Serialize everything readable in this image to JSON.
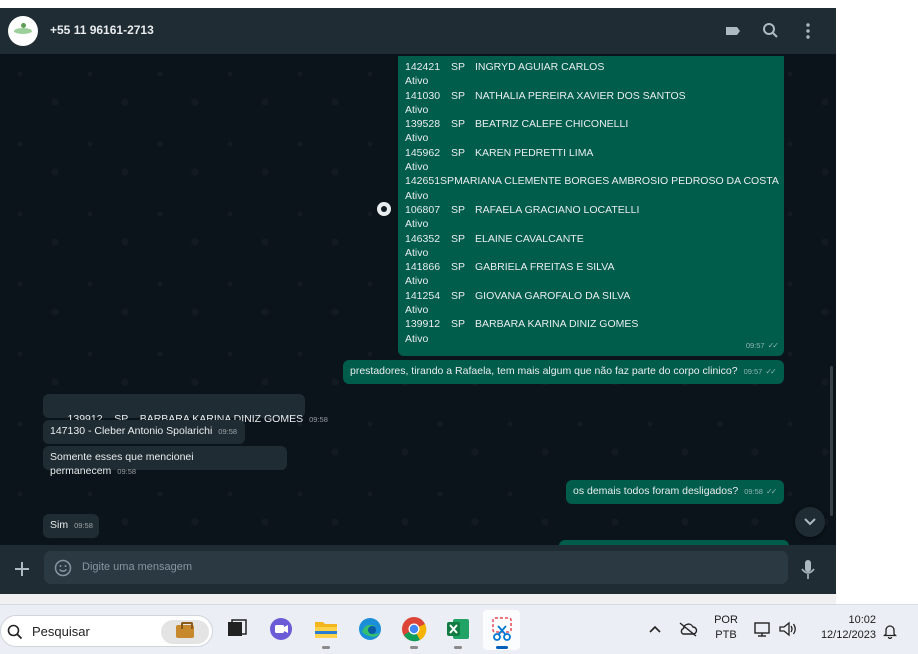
{
  "header": {
    "contact": "+55 11 96161-2713",
    "icons": [
      "label-icon",
      "search-icon",
      "menu-icon"
    ]
  },
  "list_rows": [
    {
      "id": "142421",
      "uf": "SP",
      "name": "INGRYD AGUIAR CARLOS",
      "status": "Ativo"
    },
    {
      "id": "141030",
      "uf": "SP",
      "name": "NATHALIA PEREIRA XAVIER DOS SANTOS",
      "status": "Ativo"
    },
    {
      "id": "139528",
      "uf": "SP",
      "name": "BEATRIZ CALEFE CHICONELLI",
      "status": "Ativo"
    },
    {
      "id": "145962",
      "uf": "SP",
      "name": "KAREN PEDRETTI LIMA",
      "status": "Ativo"
    },
    {
      "id": "142651",
      "uf": "SP",
      "name": "MARIANA CLEMENTE BORGES AMBROSIO PEDROSO DA COSTA",
      "status": "Ativo"
    },
    {
      "id": "106807",
      "uf": "SP",
      "name": "RAFAELA GRACIANO LOCATELLI",
      "status": "Ativo"
    },
    {
      "id": "146352",
      "uf": "SP",
      "name": "ELAINE CAVALCANTE",
      "status": "Ativo"
    },
    {
      "id": "141866",
      "uf": "SP",
      "name": "GABRIELA FREITAS E SILVA",
      "status": "Ativo"
    },
    {
      "id": "141254",
      "uf": "SP",
      "name": "GIOVANA GAROFALO DA SILVA",
      "status": "Ativo"
    },
    {
      "id": "139912",
      "uf": "SP",
      "name": "BARBARA KARINA DINIZ GOMES",
      "status": "Ativo"
    }
  ],
  "list_time": "09:57",
  "messages": {
    "m1": {
      "text": "prestadores, tirando a Rafaela, tem mais algum que não faz parte do corpo clinico?",
      "time": "09:57"
    },
    "m2": {
      "text": "139912    SP    BARBARA KARINA DINIZ GOMES",
      "time": "09:58"
    },
    "m3": {
      "text": "147130 - Cleber Antonio Spolarichi",
      "time": "09:58"
    },
    "m4": {
      "text": "Somente esses que mencionei permanecem",
      "time": "09:58"
    },
    "m5": {
      "text": "os demais todos foram desligados?",
      "time": "09:58"
    },
    "m6": {
      "text": "Sim",
      "time": "09:58"
    }
  },
  "footer": {
    "placeholder": "Digite uma mensagem"
  },
  "taskbar": {
    "search_label": "Pesquisar",
    "apps": [
      "work-bag-icon",
      "task-view-icon",
      "teams-icon",
      "file-explorer-icon",
      "edge-icon",
      "chrome-icon",
      "excel-icon",
      "snipping-tool-icon"
    ],
    "lang_top": "POR",
    "lang_bottom": "PTB",
    "time": "10:02",
    "date": "12/12/2023"
  },
  "colors": {
    "outgoing": "#005c4b",
    "incoming": "#202c33",
    "background": "#0b141a",
    "header": "#202c33"
  }
}
